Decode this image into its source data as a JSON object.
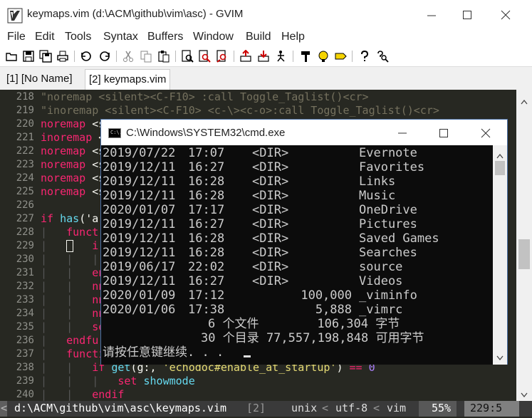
{
  "gvim": {
    "title": "keymaps.vim (d:\\ACM\\github\\vim\\asc) - GVIM",
    "url_peek": "https://github.com/gleonard/100/awesome-vim-tabs",
    "menu": [
      "File",
      "Edit",
      "Tools",
      "Syntax",
      "Buffers",
      "Window",
      "Build",
      "Help"
    ],
    "toolbar": [
      "open-icon",
      "save-icon",
      "save-all-icon",
      "print-icon",
      "undo-icon",
      "redo-icon",
      "cut-icon",
      "copy-icon",
      "paste-icon",
      "find-icon",
      "find-next-icon",
      "find-prev-icon",
      "load-session-icon",
      "save-session-icon",
      "run-script-icon",
      "make-icon",
      "run-ctags-icon",
      "tag-jump-icon",
      "help-icon",
      "help-search-icon"
    ],
    "tabs": [
      {
        "label": "[1] [No Name]",
        "active": false
      },
      {
        "label": "[2] keymaps.vim",
        "active": true
      }
    ],
    "lines": [
      {
        "num": "218",
        "segs": [
          [
            "comment",
            "\"noremap <silent><C-F10> :call Toggle_Taglist()<cr>"
          ]
        ]
      },
      {
        "num": "219",
        "segs": [
          [
            "comment",
            "\"inoremap <silent><C-F10> <c-\\><c-o>:call Toggle_Taglist()<cr>"
          ]
        ]
      },
      {
        "num": "220",
        "segs": [
          [
            "kw",
            "noremap"
          ],
          [
            "plain",
            " <s"
          ]
        ]
      },
      {
        "num": "221",
        "segs": [
          [
            "kw",
            "inoremap"
          ],
          [
            "plain",
            " <"
          ]
        ]
      },
      {
        "num": "222",
        "segs": [
          [
            "kw",
            "noremap"
          ],
          [
            "plain",
            " <s"
          ]
        ]
      },
      {
        "num": "223",
        "segs": [
          [
            "kw",
            "noremap"
          ],
          [
            "plain",
            " <s"
          ]
        ]
      },
      {
        "num": "224",
        "segs": [
          [
            "kw",
            "noremap"
          ],
          [
            "plain",
            " <s"
          ]
        ]
      },
      {
        "num": "225",
        "segs": [
          [
            "kw",
            "noremap"
          ],
          [
            "plain",
            " <s"
          ]
        ]
      },
      {
        "num": "226",
        "segs": []
      },
      {
        "num": "227",
        "segs": [
          [
            "kw",
            "if"
          ],
          [
            "plain",
            " "
          ],
          [
            "fn",
            "has"
          ],
          [
            "plain",
            "('a"
          ]
        ]
      },
      {
        "num": "228",
        "segs": [
          [
            "guide",
            "|   "
          ],
          [
            "kw",
            "funct"
          ]
        ]
      },
      {
        "num": "229",
        "segs": [
          [
            "guide",
            "|   "
          ],
          [
            "plain",
            " "
          ],
          [
            "plain",
            "   "
          ],
          [
            "kw",
            "i"
          ]
        ]
      },
      {
        "num": "230",
        "segs": [
          [
            "guide",
            "|   |   |"
          ]
        ]
      },
      {
        "num": "231",
        "segs": [
          [
            "guide",
            "|   |   "
          ],
          [
            "kw",
            "en"
          ]
        ]
      },
      {
        "num": "232",
        "segs": [
          [
            "guide",
            "|   |   "
          ],
          [
            "kw",
            "nn"
          ]
        ]
      },
      {
        "num": "233",
        "segs": [
          [
            "guide",
            "|   |   "
          ],
          [
            "kw",
            "nn"
          ]
        ]
      },
      {
        "num": "234",
        "segs": [
          [
            "guide",
            "|   |   "
          ],
          [
            "kw",
            "nn"
          ]
        ]
      },
      {
        "num": "235",
        "segs": [
          [
            "guide",
            "|   |   "
          ],
          [
            "kw",
            "se"
          ]
        ]
      },
      {
        "num": "236",
        "segs": [
          [
            "guide",
            "|   "
          ],
          [
            "kw",
            "endfu"
          ]
        ]
      },
      {
        "num": "237",
        "segs": [
          [
            "guide",
            "|   "
          ],
          [
            "kw",
            "functi"
          ]
        ]
      },
      {
        "num": "238",
        "segs": [
          [
            "guide",
            "|   |   "
          ],
          [
            "kw",
            "if"
          ],
          [
            "plain",
            " "
          ],
          [
            "fn",
            "get"
          ],
          [
            "plain",
            "(g:, "
          ],
          [
            "str",
            "'echodoc#enable_at_startup'"
          ],
          [
            "plain",
            ") "
          ],
          [
            "kw",
            "=="
          ],
          [
            "plain",
            " "
          ],
          [
            "num",
            "0"
          ]
        ]
      },
      {
        "num": "239",
        "segs": [
          [
            "guide",
            "|   |   |   "
          ],
          [
            "kw",
            "set"
          ],
          [
            "plain",
            " "
          ],
          [
            "fn",
            "showmode"
          ]
        ]
      },
      {
        "num": "240",
        "segs": [
          [
            "guide",
            "|   |   "
          ],
          [
            "kw",
            "endif"
          ]
        ]
      }
    ],
    "status": {
      "mode_marker": "<",
      "file": "d:\\ACM\\github\\vim\\asc\\keymaps.vim",
      "buffer": "[2]",
      "fileformat": "unix",
      "encoding": "utf-8",
      "filetype": "vim",
      "percent": "55%",
      "position": "229:5"
    }
  },
  "cmd": {
    "title": "C:\\Windows\\SYSTEM32\\cmd.exe",
    "icon_text": "C:\\.",
    "rows": [
      {
        "date": "2019/07/22",
        "time": "17:07",
        "type": "<DIR>",
        "size": "",
        "name": "Evernote"
      },
      {
        "date": "2019/12/11",
        "time": "16:27",
        "type": "<DIR>",
        "size": "",
        "name": "Favorites"
      },
      {
        "date": "2019/12/11",
        "time": "16:28",
        "type": "<DIR>",
        "size": "",
        "name": "Links"
      },
      {
        "date": "2019/12/11",
        "time": "16:28",
        "type": "<DIR>",
        "size": "",
        "name": "Music"
      },
      {
        "date": "2020/01/07",
        "time": "17:17",
        "type": "<DIR>",
        "size": "",
        "name": "OneDrive"
      },
      {
        "date": "2019/12/11",
        "time": "16:27",
        "type": "<DIR>",
        "size": "",
        "name": "Pictures"
      },
      {
        "date": "2019/12/11",
        "time": "16:28",
        "type": "<DIR>",
        "size": "",
        "name": "Saved Games"
      },
      {
        "date": "2019/12/11",
        "time": "16:28",
        "type": "<DIR>",
        "size": "",
        "name": "Searches"
      },
      {
        "date": "2019/06/17",
        "time": "22:02",
        "type": "<DIR>",
        "size": "",
        "name": "source"
      },
      {
        "date": "2019/12/11",
        "time": "16:27",
        "type": "<DIR>",
        "size": "",
        "name": "Videos"
      },
      {
        "date": "2020/01/09",
        "time": "17:12",
        "type": "",
        "size": "100,000",
        "name": "_viminfo"
      },
      {
        "date": "2020/01/06",
        "time": "17:38",
        "type": "",
        "size": "5,888",
        "name": "_vimrc"
      }
    ],
    "summary_files": "6 个文件        106,304 字节",
    "summary_dirs": "30 个目录 77,557,198,848 可用字节",
    "prompt": "请按任意键继续. . ."
  },
  "colors": {
    "editor_bg": "#272822",
    "keyword": "#f92672",
    "function": "#66d9ef",
    "string": "#e6db74",
    "number": "#ae81ff",
    "comment": "#75715e",
    "cmd_bg": "#0c0c0c",
    "cmd_fg": "#cccccc"
  }
}
